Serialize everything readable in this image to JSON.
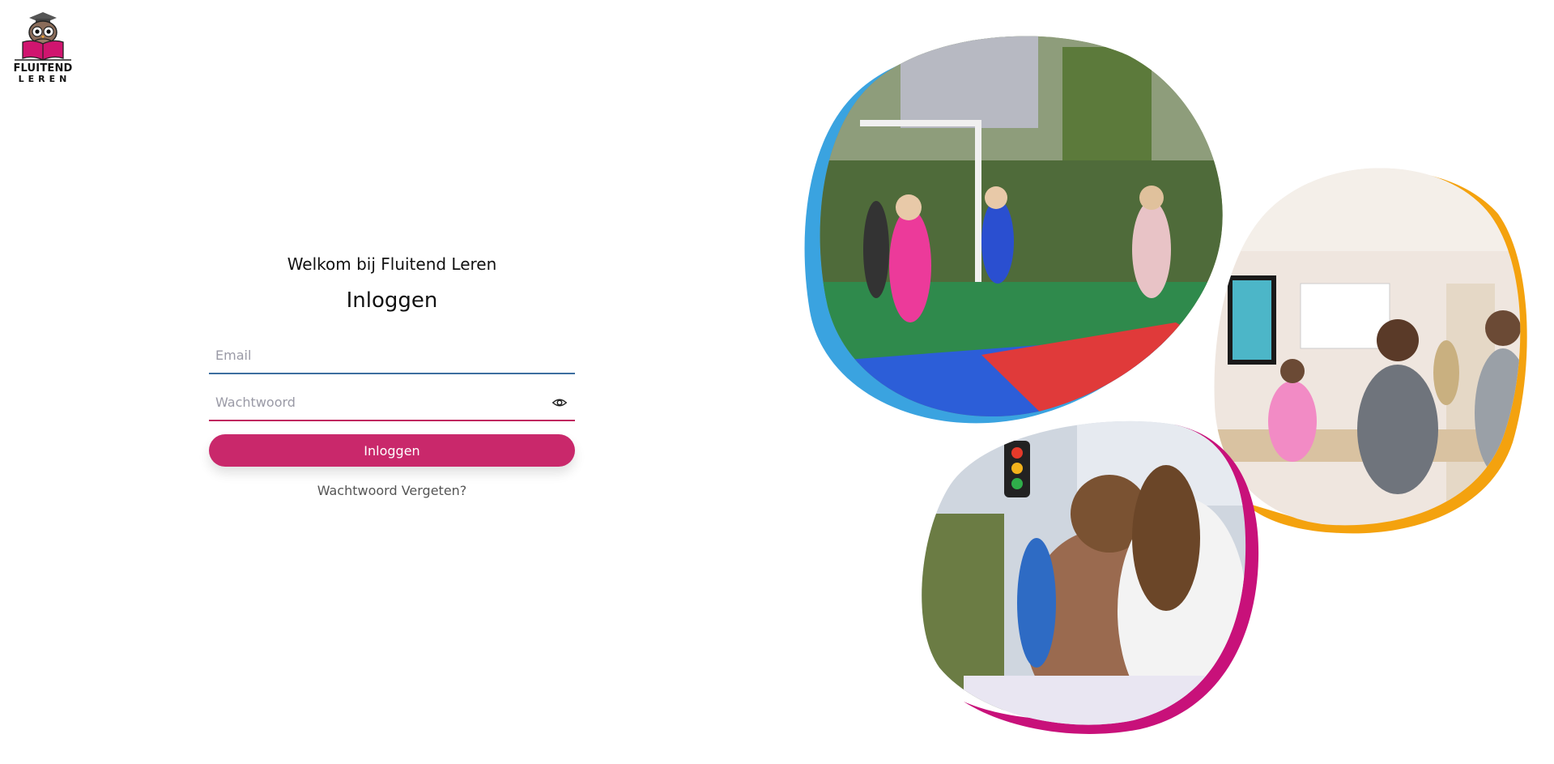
{
  "brand": {
    "logo_line1": "FLUITEND",
    "logo_line2": "LEREN",
    "logo_icon": "owl-reading-book-icon"
  },
  "login": {
    "welcome": "Welkom bij Fluitend Leren",
    "title": "Inloggen",
    "email_placeholder": "Email",
    "password_placeholder": "Wachtwoord",
    "password_toggle_icon": "eye-icon",
    "submit_label": "Inloggen",
    "forgot_label": "Wachtwoord Vergeten?"
  },
  "colors": {
    "primary": "#c9286b",
    "field_email_border": "#3d6fa0",
    "field_password_border": "#c0285f",
    "blob_blue": "#3aa3e0",
    "blob_orange": "#f4a20e",
    "blob_magenta": "#c8117a"
  },
  "photos": [
    {
      "name": "photo-schoolyard-game",
      "accent": "blue"
    },
    {
      "name": "photo-classroom-standing",
      "accent": "orange"
    },
    {
      "name": "photo-students-writing",
      "accent": "magenta"
    }
  ]
}
